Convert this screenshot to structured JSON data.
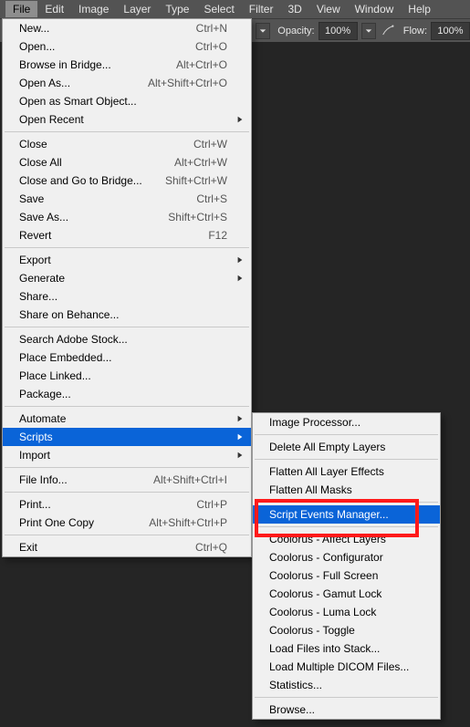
{
  "menubar": {
    "file": "File",
    "edit": "Edit",
    "image": "Image",
    "layer": "Layer",
    "type": "Type",
    "select": "Select",
    "filter": "Filter",
    "three_d": "3D",
    "view": "View",
    "window": "Window",
    "help": "Help"
  },
  "toolbar": {
    "opacity_label": "Opacity:",
    "opacity_value": "100%",
    "flow_label": "Flow:",
    "flow_value": "100%"
  },
  "file_menu": {
    "new": "New...",
    "new_sc": "Ctrl+N",
    "open": "Open...",
    "open_sc": "Ctrl+O",
    "browse": "Browse in Bridge...",
    "browse_sc": "Alt+Ctrl+O",
    "openas": "Open As...",
    "openas_sc": "Alt+Shift+Ctrl+O",
    "opensmart": "Open as Smart Object...",
    "openrecent": "Open Recent",
    "close": "Close",
    "close_sc": "Ctrl+W",
    "closeall": "Close All",
    "closeall_sc": "Alt+Ctrl+W",
    "closebridge": "Close and Go to Bridge...",
    "closebridge_sc": "Shift+Ctrl+W",
    "save": "Save",
    "save_sc": "Ctrl+S",
    "saveas": "Save As...",
    "saveas_sc": "Shift+Ctrl+S",
    "revert": "Revert",
    "revert_sc": "F12",
    "export": "Export",
    "generate": "Generate",
    "share": "Share...",
    "behance": "Share on Behance...",
    "search": "Search Adobe Stock...",
    "placeemb": "Place Embedded...",
    "placelnk": "Place Linked...",
    "package": "Package...",
    "automate": "Automate",
    "scripts": "Scripts",
    "import": "Import",
    "fileinfo": "File Info...",
    "fileinfo_sc": "Alt+Shift+Ctrl+I",
    "print": "Print...",
    "print_sc": "Ctrl+P",
    "printone": "Print One Copy",
    "printone_sc": "Alt+Shift+Ctrl+P",
    "exit": "Exit",
    "exit_sc": "Ctrl+Q"
  },
  "scripts_menu": {
    "imgproc": "Image Processor...",
    "delempty": "Delete All Empty Layers",
    "flatfx": "Flatten All Layer Effects",
    "flatmasks": "Flatten All Masks",
    "sem": "Script Events Manager...",
    "c_affect": "Coolorus - Affect Layers",
    "c_config": "Coolorus - Configurator",
    "c_full": "Coolorus - Full Screen",
    "c_gamut": "Coolorus - Gamut Lock",
    "c_luma": "Coolorus - Luma Lock",
    "c_toggle": "Coolorus - Toggle",
    "loadstack": "Load Files into Stack...",
    "loaddicom": "Load Multiple DICOM Files...",
    "stats": "Statistics...",
    "browse": "Browse..."
  }
}
